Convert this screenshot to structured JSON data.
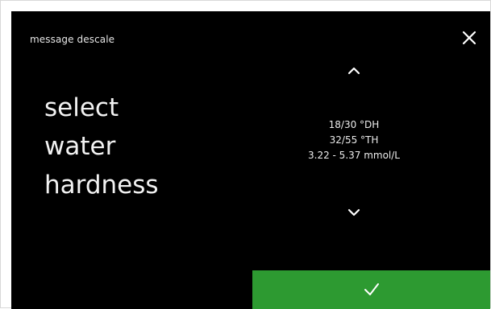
{
  "header": {
    "title": "message descale"
  },
  "prompt": {
    "lines": [
      "select",
      "water",
      "hardness"
    ]
  },
  "selector": {
    "values": [
      "18/30 °DH",
      "32/55 °TH",
      "3.22 - 5.37 mmol/L"
    ]
  },
  "icons": {
    "close": "close-icon",
    "up": "chevron-up-icon",
    "down": "chevron-down-icon",
    "confirm": "checkmark-icon"
  },
  "colors": {
    "background": "#000000",
    "text": "#f2f2f2",
    "confirm_button": "#2d9a31"
  }
}
